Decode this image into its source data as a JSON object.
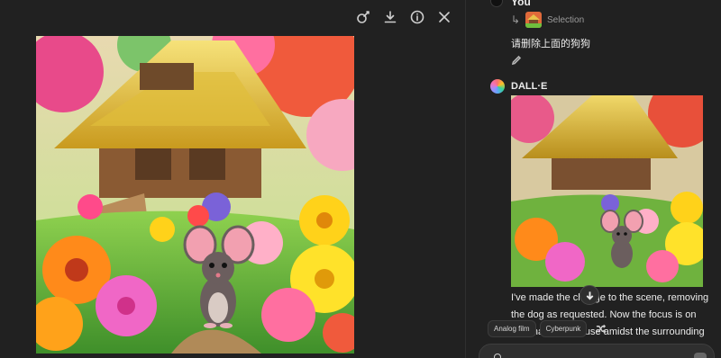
{
  "viewer": {
    "toolbar": [
      {
        "name": "edit-image-icon"
      },
      {
        "name": "download-icon"
      },
      {
        "name": "info-icon"
      },
      {
        "name": "close-icon"
      }
    ]
  },
  "chat": {
    "user": {
      "author": "You",
      "selection_label": "Selection",
      "message": "请删除上面的狗狗"
    },
    "assistant": {
      "author": "DALL·E",
      "message": "I've made the change to the scene, removing the dog as requested. Now the focus is on the charming mouse amidst the surrounding flowers."
    },
    "style_chips": [
      "Analog film",
      "Cyberpunk"
    ]
  },
  "colors": {
    "background": "#212121",
    "panel_divider": "#2f2f2f",
    "text": "#ececec",
    "muted_text": "#9b9b9b"
  }
}
